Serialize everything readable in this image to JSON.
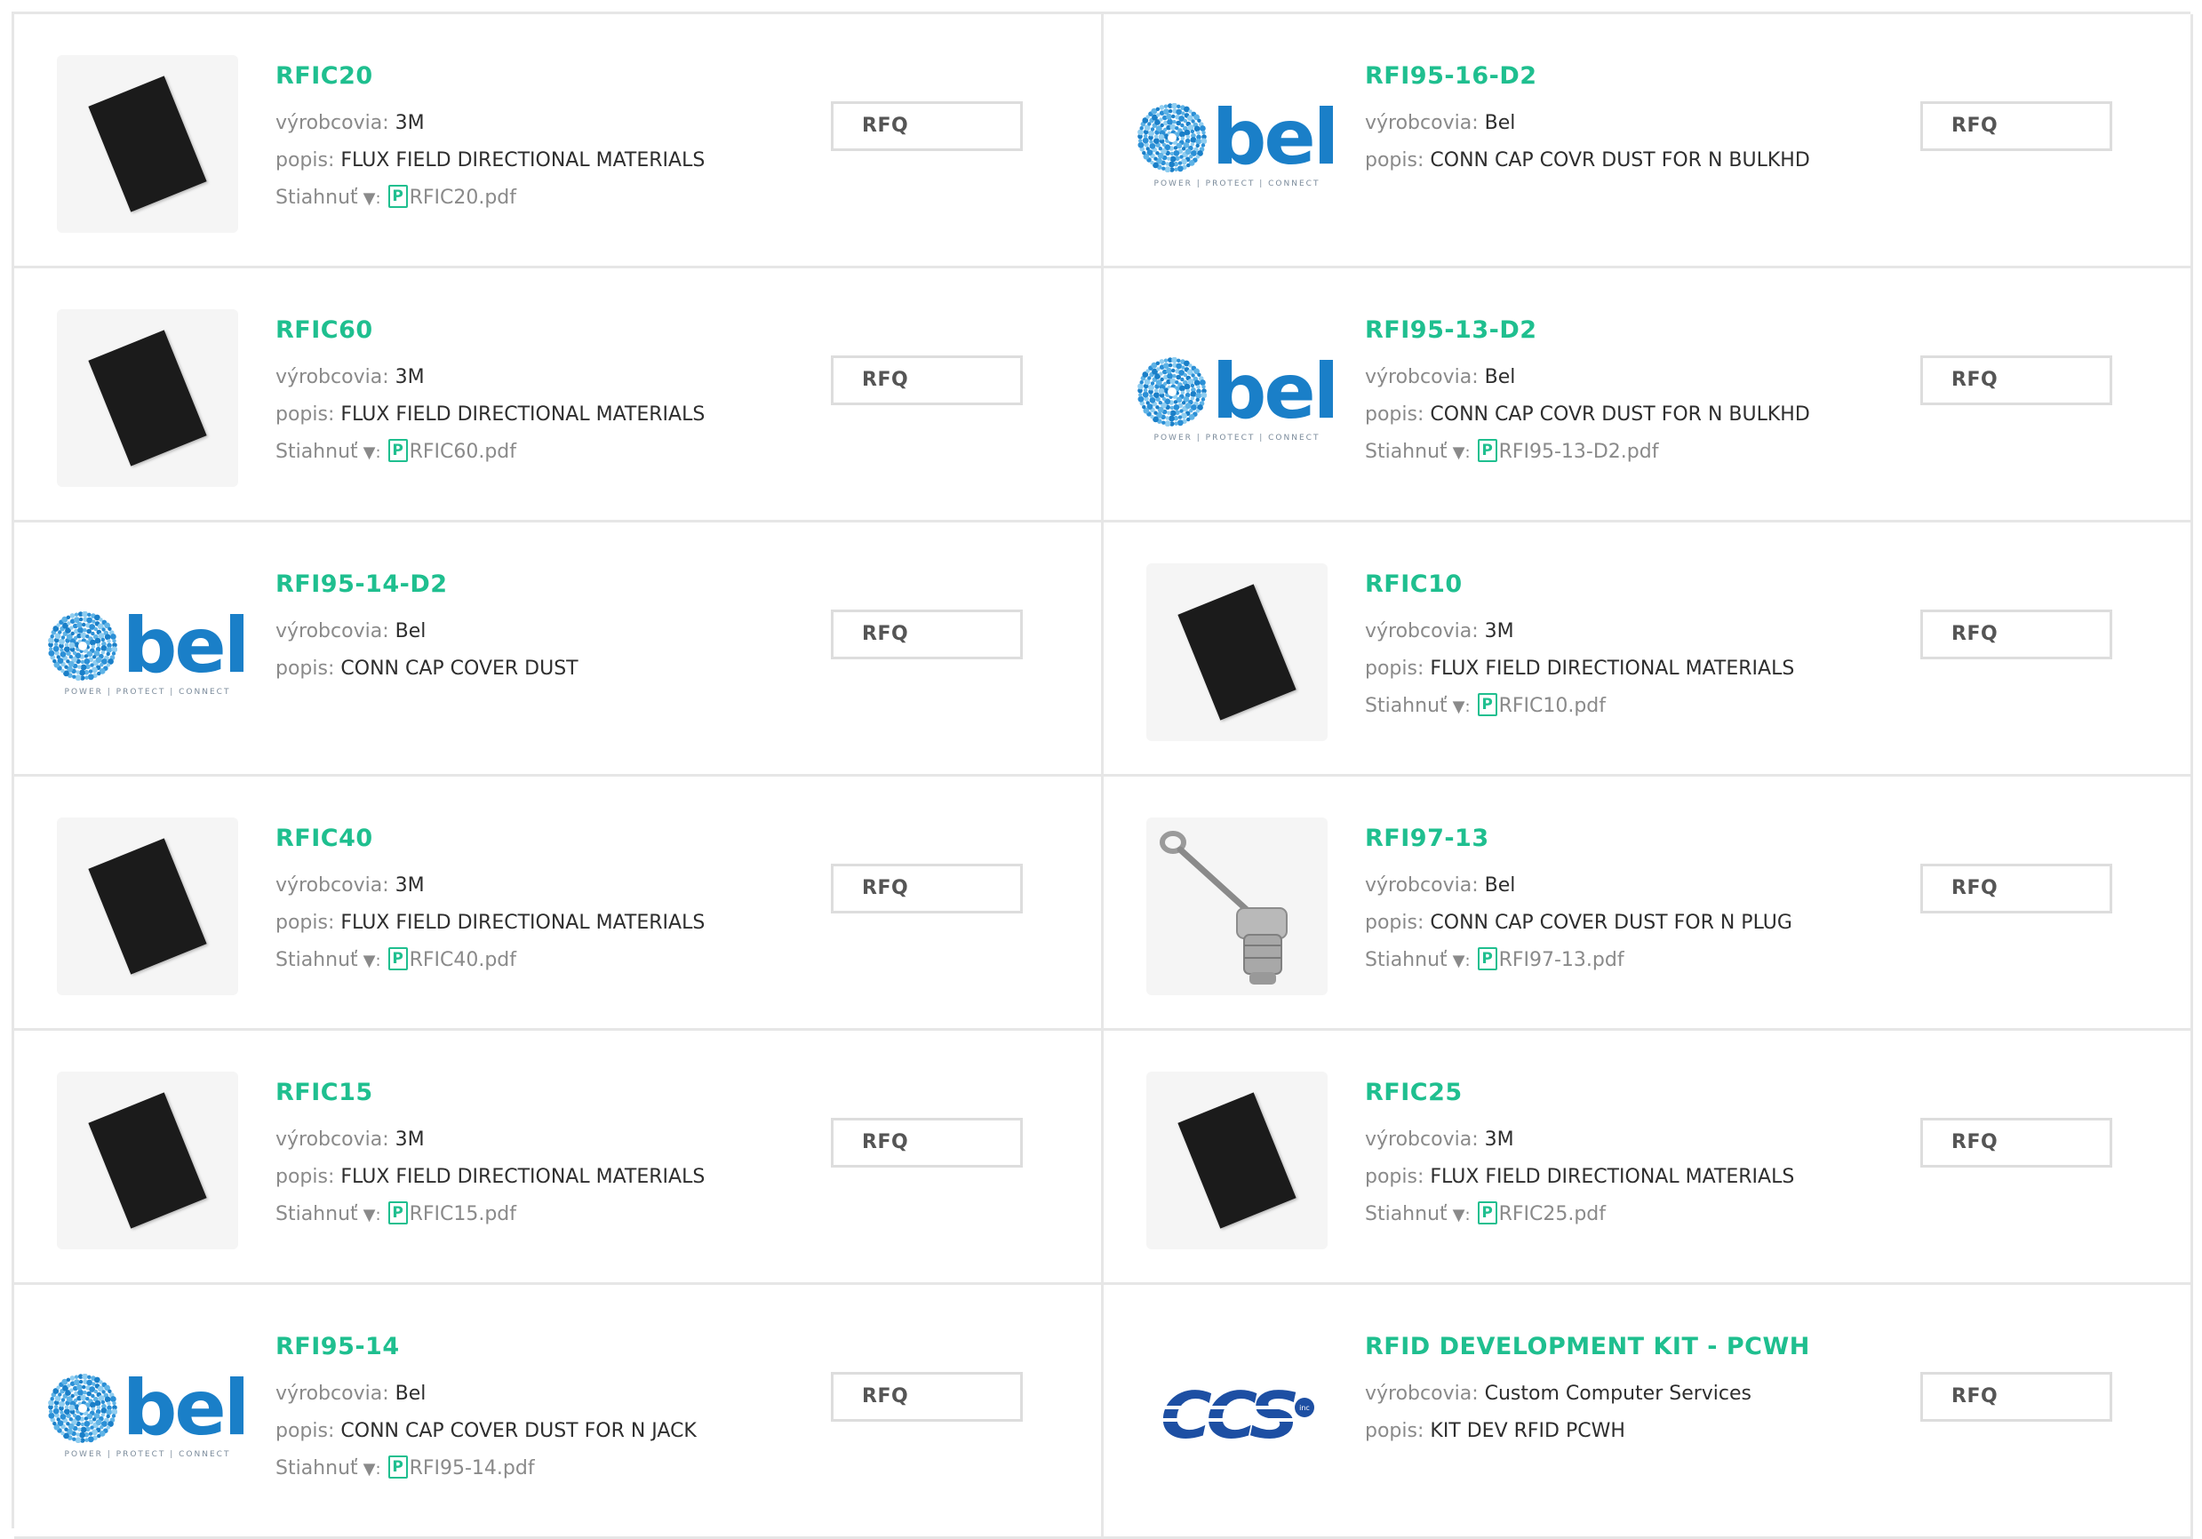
{
  "labels": {
    "manufacturer": "výrobcovia:",
    "description": "popis:",
    "download": "Stiahnuť",
    "download_arrow": "▼:",
    "rfq": "RFQ",
    "pdf_glyph": "P"
  },
  "colors": {
    "part_number": "#1fbf8f",
    "bel_blue": "#1a7fc8",
    "ccs_blue": "#1d4fa3",
    "border": "#e6e6e6"
  },
  "logo_text": {
    "bel_word": "bel",
    "bel_tagline": "POWER | PROTECT | CONNECT",
    "ccs_word": "CCS",
    "ccs_suffix": "inc"
  },
  "products": [
    {
      "part_number": "RFIC20",
      "manufacturer": "3M",
      "description": "FLUX FIELD DIRECTIONAL MATERIALS",
      "datasheet": "RFIC20.pdf",
      "image_icon": "black-sheet"
    },
    {
      "part_number": "RFI95-16-D2",
      "manufacturer": "Bel",
      "description": "CONN CAP COVR DUST FOR N BULKHD",
      "datasheet": null,
      "image_icon": "bel-logo"
    },
    {
      "part_number": "RFIC60",
      "manufacturer": "3M",
      "description": "FLUX FIELD DIRECTIONAL MATERIALS",
      "datasheet": "RFIC60.pdf",
      "image_icon": "black-sheet"
    },
    {
      "part_number": "RFI95-13-D2",
      "manufacturer": "Bel",
      "description": "CONN CAP COVR DUST FOR N BULKHD",
      "datasheet": "RFI95-13-D2.pdf",
      "image_icon": "bel-logo"
    },
    {
      "part_number": "RFI95-14-D2",
      "manufacturer": "Bel",
      "description": "CONN CAP COVER DUST",
      "datasheet": null,
      "image_icon": "bel-logo"
    },
    {
      "part_number": "RFIC10",
      "manufacturer": "3M",
      "description": "FLUX FIELD DIRECTIONAL MATERIALS",
      "datasheet": "RFIC10.pdf",
      "image_icon": "black-sheet"
    },
    {
      "part_number": "RFIC40",
      "manufacturer": "3M",
      "description": "FLUX FIELD DIRECTIONAL MATERIALS",
      "datasheet": "RFIC40.pdf",
      "image_icon": "black-sheet"
    },
    {
      "part_number": "RFI97-13",
      "manufacturer": "Bel",
      "description": "CONN CAP COVER DUST FOR N PLUG",
      "datasheet": "RFI97-13.pdf",
      "image_icon": "dust-cap-photo"
    },
    {
      "part_number": "RFIC15",
      "manufacturer": "3M",
      "description": "FLUX FIELD DIRECTIONAL MATERIALS",
      "datasheet": "RFIC15.pdf",
      "image_icon": "black-sheet"
    },
    {
      "part_number": "RFIC25",
      "manufacturer": "3M",
      "description": "FLUX FIELD DIRECTIONAL MATERIALS",
      "datasheet": "RFIC25.pdf",
      "image_icon": "black-sheet"
    },
    {
      "part_number": "RFI95-14",
      "manufacturer": "Bel",
      "description": "CONN CAP COVER DUST FOR N JACK",
      "datasheet": "RFI95-14.pdf",
      "image_icon": "bel-logo"
    },
    {
      "part_number": "RFID DEVELOPMENT KIT - PCWH",
      "manufacturer": "Custom Computer Services",
      "description": "KIT DEV RFID PCWH",
      "datasheet": null,
      "image_icon": "ccs-logo"
    }
  ]
}
